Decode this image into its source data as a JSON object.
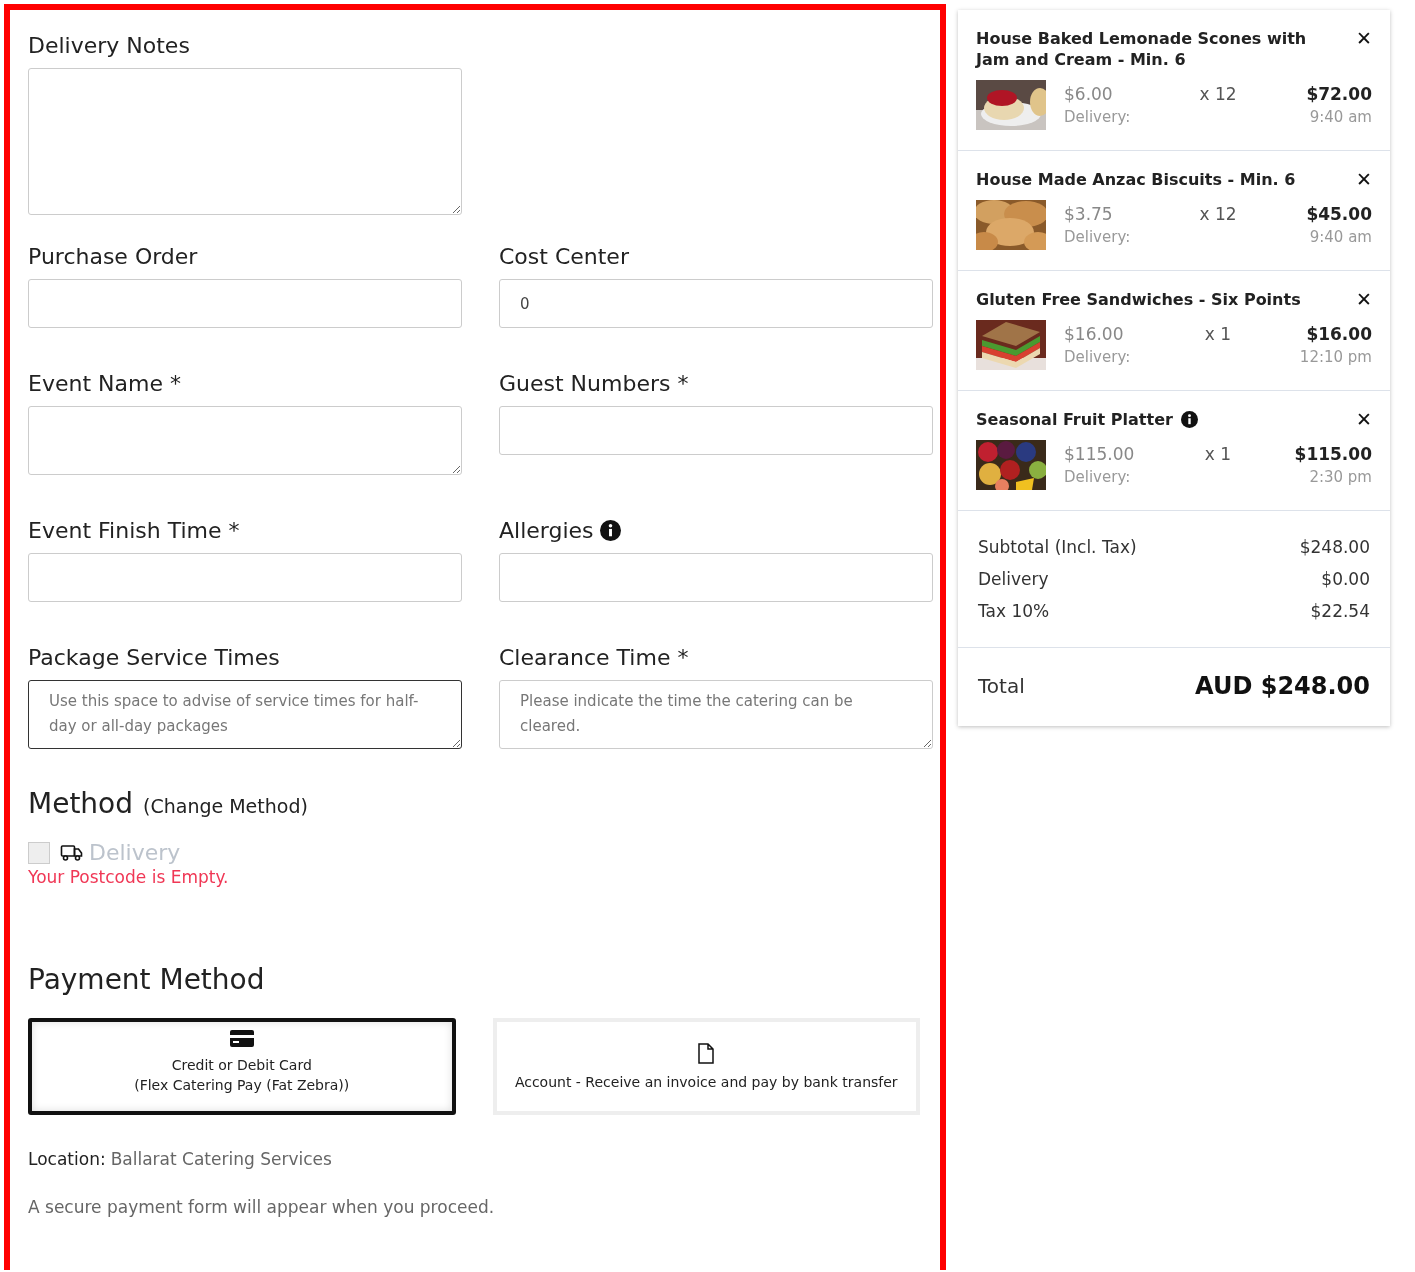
{
  "form": {
    "rows": [
      {
        "fields": [
          {
            "label": "Delivery Notes",
            "kind": "textarea",
            "focused": false
          }
        ]
      },
      {
        "fields": [
          {
            "label": "Purchase Order",
            "kind": "input",
            "focused": false
          },
          {
            "label": "Cost Center",
            "kind": "input",
            "value": "0",
            "focused": false
          }
        ]
      },
      {
        "fields": [
          {
            "label": "Event Name *",
            "kind": "textarea",
            "focused": false
          },
          {
            "label": "Guest Numbers *",
            "kind": "input",
            "focused": false
          }
        ]
      },
      {
        "fields": [
          {
            "label": "Event Finish Time *",
            "kind": "input",
            "focused": false
          },
          {
            "label": "Allergies",
            "info": true,
            "kind": "input",
            "focused": false
          }
        ]
      },
      {
        "fields": [
          {
            "label": "Package Service Times",
            "kind": "textarea",
            "placeholder": "Use this space to advise of service times for half-day or all-day packages",
            "focused": true
          },
          {
            "label": "Clearance Time *",
            "kind": "textarea",
            "placeholder": "Please indicate the time the catering can be cleared.",
            "focused": false
          }
        ]
      }
    ]
  },
  "method": {
    "heading": "Method",
    "link": "(Change Method)",
    "option": {
      "label": "Delivery",
      "checked": false,
      "disabled": true
    },
    "error": "Your Postcode is Empty."
  },
  "payment": {
    "heading": "Payment Method",
    "options": [
      {
        "kind": "card",
        "lines": [
          "Credit or Debit Card",
          "(Flex Catering Pay (Fat Zebra))"
        ],
        "selected": true
      },
      {
        "kind": "document",
        "lines": [
          "Account - Receive an invoice and pay by bank transfer"
        ],
        "selected": false
      }
    ],
    "location_label": "Location:",
    "location": "Ballarat Catering Services",
    "note": "A secure payment form will appear when you proceed."
  },
  "cart": {
    "items": [
      {
        "name": "House Baked Lemonade Scones with Jam and Cream - Min. 6",
        "info": false,
        "kind": "picture",
        "unit_price": "$6.00",
        "quantity": "x 12",
        "total": "$72.00",
        "delivery_label": "Delivery:",
        "delivery_time": "9:40 am",
        "remove": "✕"
      },
      {
        "name": "House Made Anzac Biscuits - Min. 6",
        "info": false,
        "kind": "picture",
        "unit_price": "$3.75",
        "quantity": "x 12",
        "total": "$45.00",
        "delivery_label": "Delivery:",
        "delivery_time": "9:40 am",
        "remove": "✕"
      },
      {
        "name": "Gluten Free Sandwiches - Six Points",
        "info": false,
        "kind": "picture",
        "unit_price": "$16.00",
        "quantity": "x 1",
        "total": "$16.00",
        "delivery_label": "Delivery:",
        "delivery_time": "12:10 pm",
        "remove": "✕"
      },
      {
        "name": "Seasonal Fruit Platter",
        "info": true,
        "kind": "picture",
        "unit_price": "$115.00",
        "quantity": "x 1",
        "total": "$115.00",
        "delivery_label": "Delivery:",
        "delivery_time": "2:30 pm",
        "remove": "✕"
      }
    ],
    "summary": [
      {
        "label": "Subtotal (Incl. Tax)",
        "value": "$248.00"
      },
      {
        "label": "Delivery",
        "value": "$0.00"
      },
      {
        "label": "Tax 10%",
        "value": "$22.54"
      }
    ],
    "total": {
      "label": "Total",
      "value": "AUD $248.00"
    }
  }
}
